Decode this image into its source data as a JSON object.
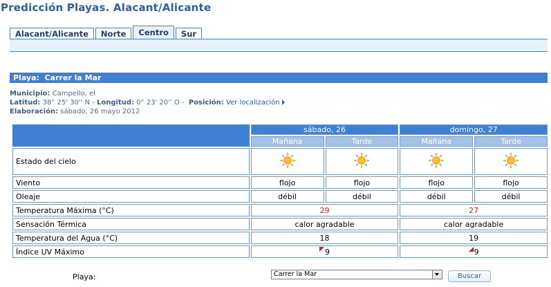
{
  "page": {
    "title": "Predicción Playas. Alacant/Alicante"
  },
  "tabs": [
    {
      "label": "Alacant/Alicante",
      "active": false
    },
    {
      "label": "Norte",
      "active": false
    },
    {
      "label": "Centro",
      "active": true
    },
    {
      "label": "Sur",
      "active": false
    }
  ],
  "beach": {
    "header_label": "Playa:",
    "header_name": "Carrer la Mar",
    "municipio_label": "Municipio:",
    "municipio": "Campello, el",
    "latitud_label": "Latitud:",
    "latitud": "38° 25' 30'' N",
    "longitud_label": "Longitud:",
    "longitud": "0° 23' 20'' O",
    "posicion_label": "Posición:",
    "posicion_link": "Ver localización",
    "elaboracion_label": "Elaboración:",
    "elaboracion": "sábado, 26 mayo 2012"
  },
  "forecast": {
    "days": [
      "sábado, 26",
      "domingo, 27"
    ],
    "periods": [
      "Mañana",
      "Tarde",
      "Mañana",
      "Tarde"
    ],
    "rows": {
      "estado_cielo": {
        "label": "Estado del cielo",
        "icons": [
          "sun-icon",
          "sun-icon",
          "sun-icon",
          "sun-icon"
        ]
      },
      "viento": {
        "label": "Viento",
        "values": [
          "flojo",
          "flojo",
          "flojo",
          "flojo"
        ]
      },
      "oleaje": {
        "label": "Oleaje",
        "values": [
          "débil",
          "débil",
          "débil",
          "débil"
        ]
      },
      "temp_max": {
        "label": "Temperatura Máxima (°C)",
        "values": [
          "29",
          "27"
        ]
      },
      "sensacion": {
        "label": "Sensación Térmica",
        "values": [
          "calor agradable",
          "calor agradable"
        ]
      },
      "temp_agua": {
        "label": "Temperatura del Agua (°C)",
        "values": [
          "18",
          "19"
        ]
      },
      "uv": {
        "label": "Índice UV Máximo",
        "values": [
          "9",
          "9"
        ]
      }
    }
  },
  "footer": {
    "playa_label": "Playa:",
    "select_value": "Carrer la Mar",
    "button_label": "Buscar"
  },
  "colors": {
    "accent": "#3f80d6",
    "title": "#2b5ea8",
    "temp": "#c0272d",
    "sun": "#f2a81d"
  }
}
